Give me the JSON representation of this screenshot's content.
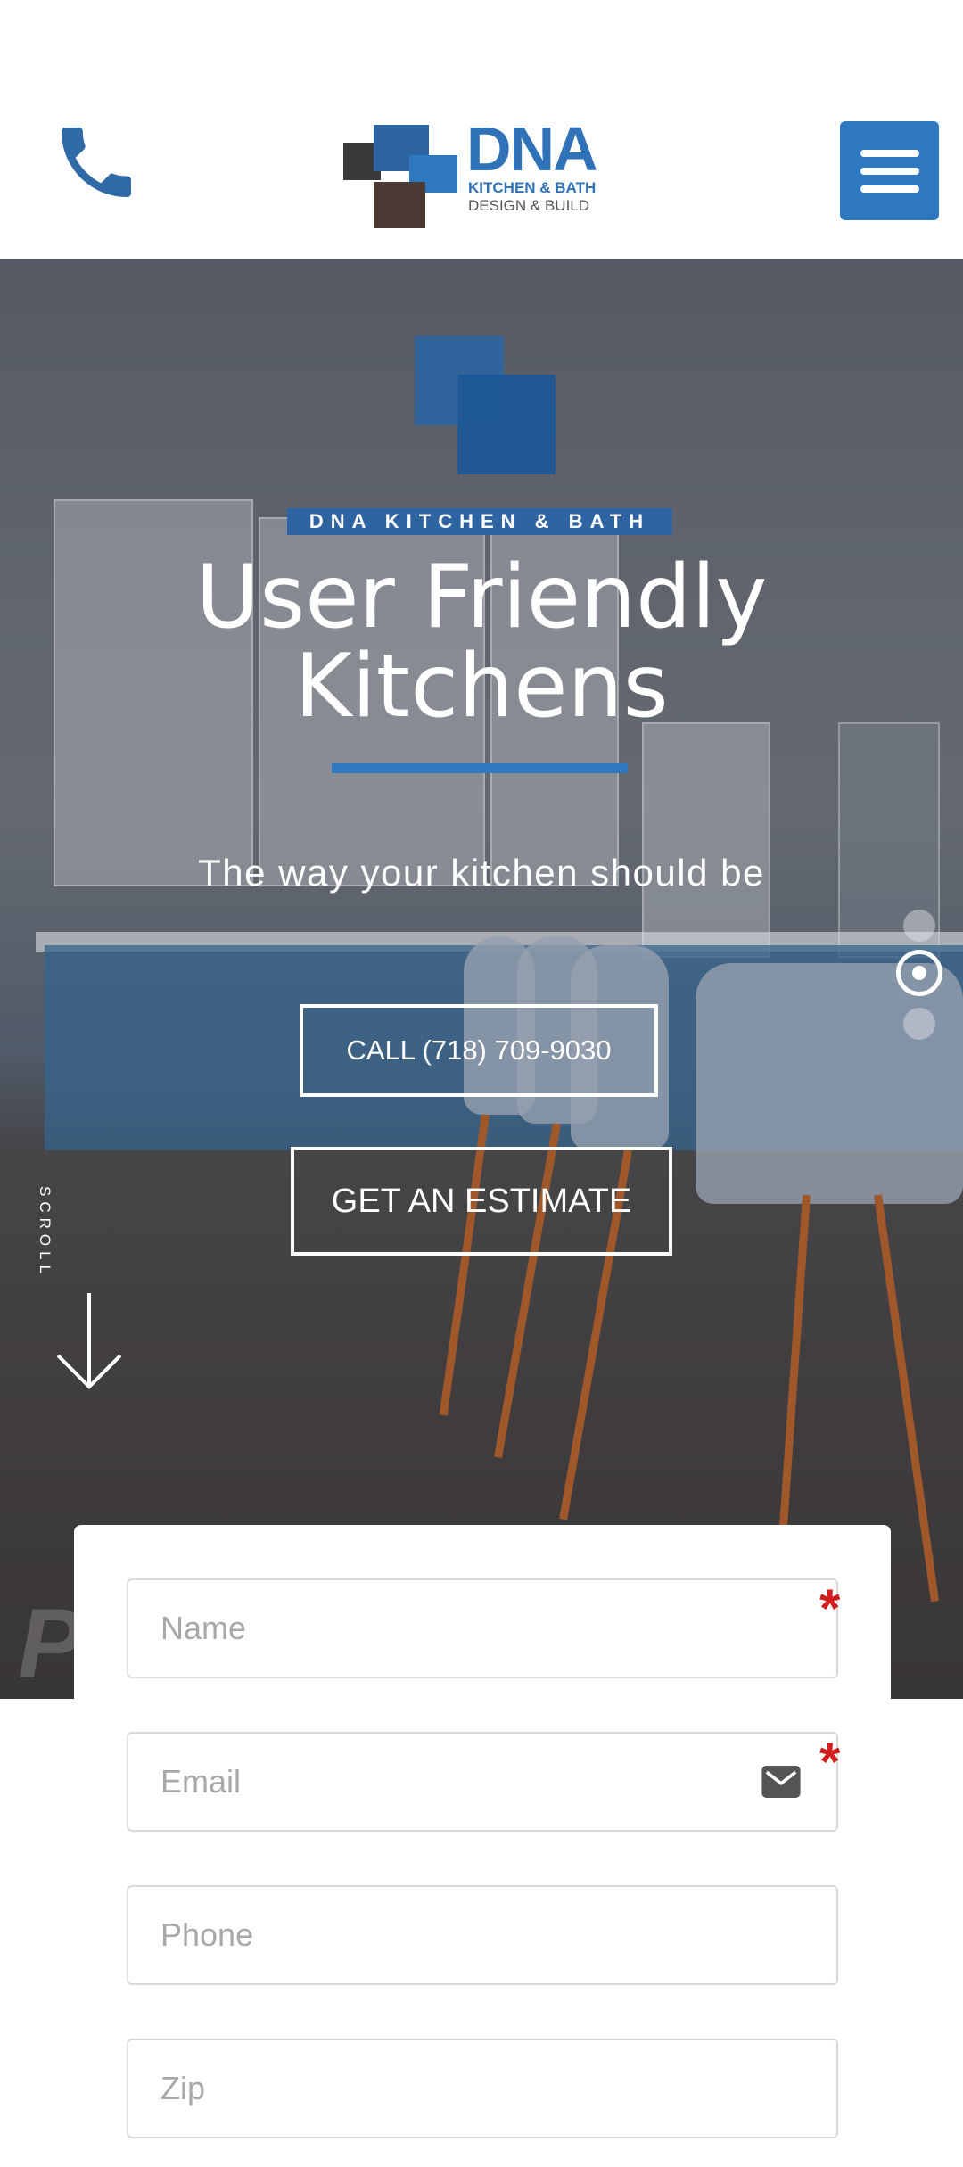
{
  "header": {
    "logo": {
      "brand": "DNA",
      "line1": "KITCHEN & BATH",
      "line2": "DESIGN & BUILD"
    }
  },
  "hero": {
    "tag": "DNA KITCHEN & BATH",
    "title_line1": "User Friendly",
    "title_line2": "Kitchens",
    "subtitle": "The way your kitchen should be",
    "call_button": "CALL (718) 709-9030",
    "estimate_button": "GET AN ESTIMATE",
    "scroll_label": "SCROLL"
  },
  "form": {
    "name_placeholder": "Name",
    "email_placeholder": "Email",
    "phone_placeholder": "Phone",
    "zip_placeholder": "Zip",
    "required_mark": "*"
  },
  "colors": {
    "brand_blue": "#2e78c0",
    "logo_dark": "#3b3b3b",
    "logo_brown": "#4a3a33",
    "required": "#d21d1d"
  },
  "icons": [
    "phone-icon",
    "hamburger-menu-icon",
    "scroll-down-arrow-icon",
    "mail-icon"
  ]
}
